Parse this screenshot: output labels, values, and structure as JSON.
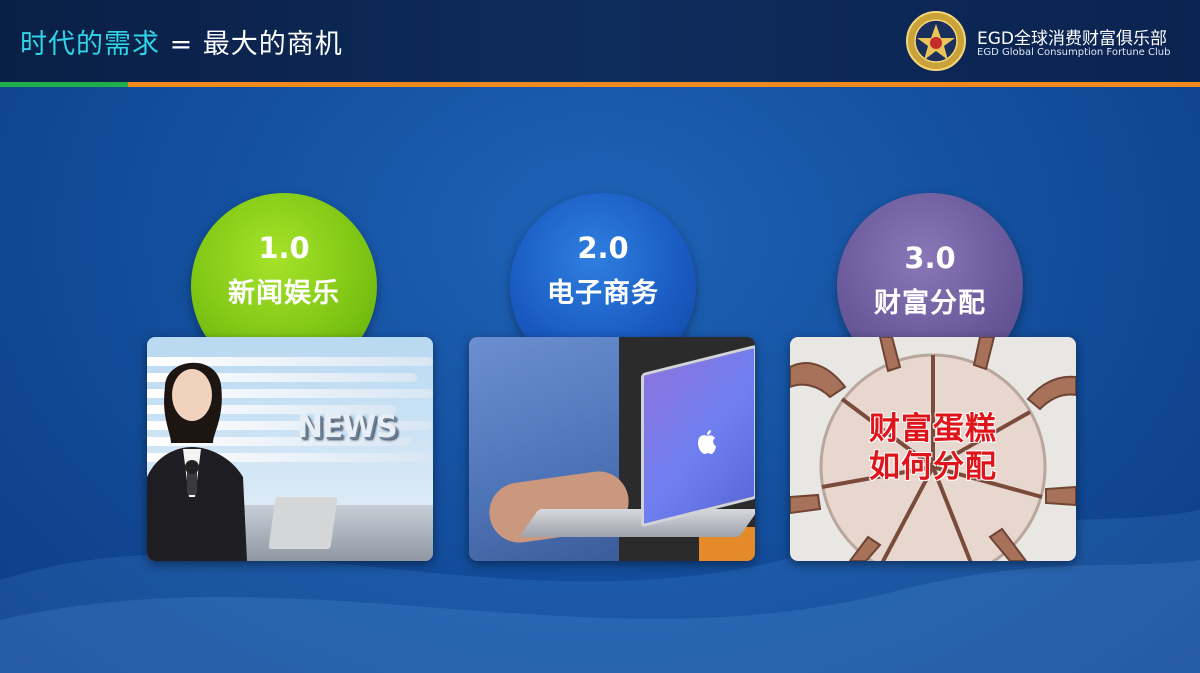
{
  "header": {
    "title_accent": "时代的需求",
    "title_rest": " = 最大的商机",
    "logo_cn": "EGD全球消费财富俱乐部",
    "logo_en": "EGD Global Consumption Fortune Club"
  },
  "colors": {
    "accent": "#2fd4e8",
    "stripe_green": "#1fae4a",
    "stripe_orange": "#f08a1c",
    "circle1": "#7ec614",
    "circle2": "#1a5bc2",
    "circle3": "#6b5a9b"
  },
  "stages": [
    {
      "number": "1.0",
      "label": "新闻娱乐",
      "image_text": "NEWS"
    },
    {
      "number": "2.0",
      "label": "电子商务"
    },
    {
      "number": "3.0",
      "label": "财富分配",
      "image_text_line1": "财富蛋糕",
      "image_text_line2": "如何分配"
    }
  ]
}
